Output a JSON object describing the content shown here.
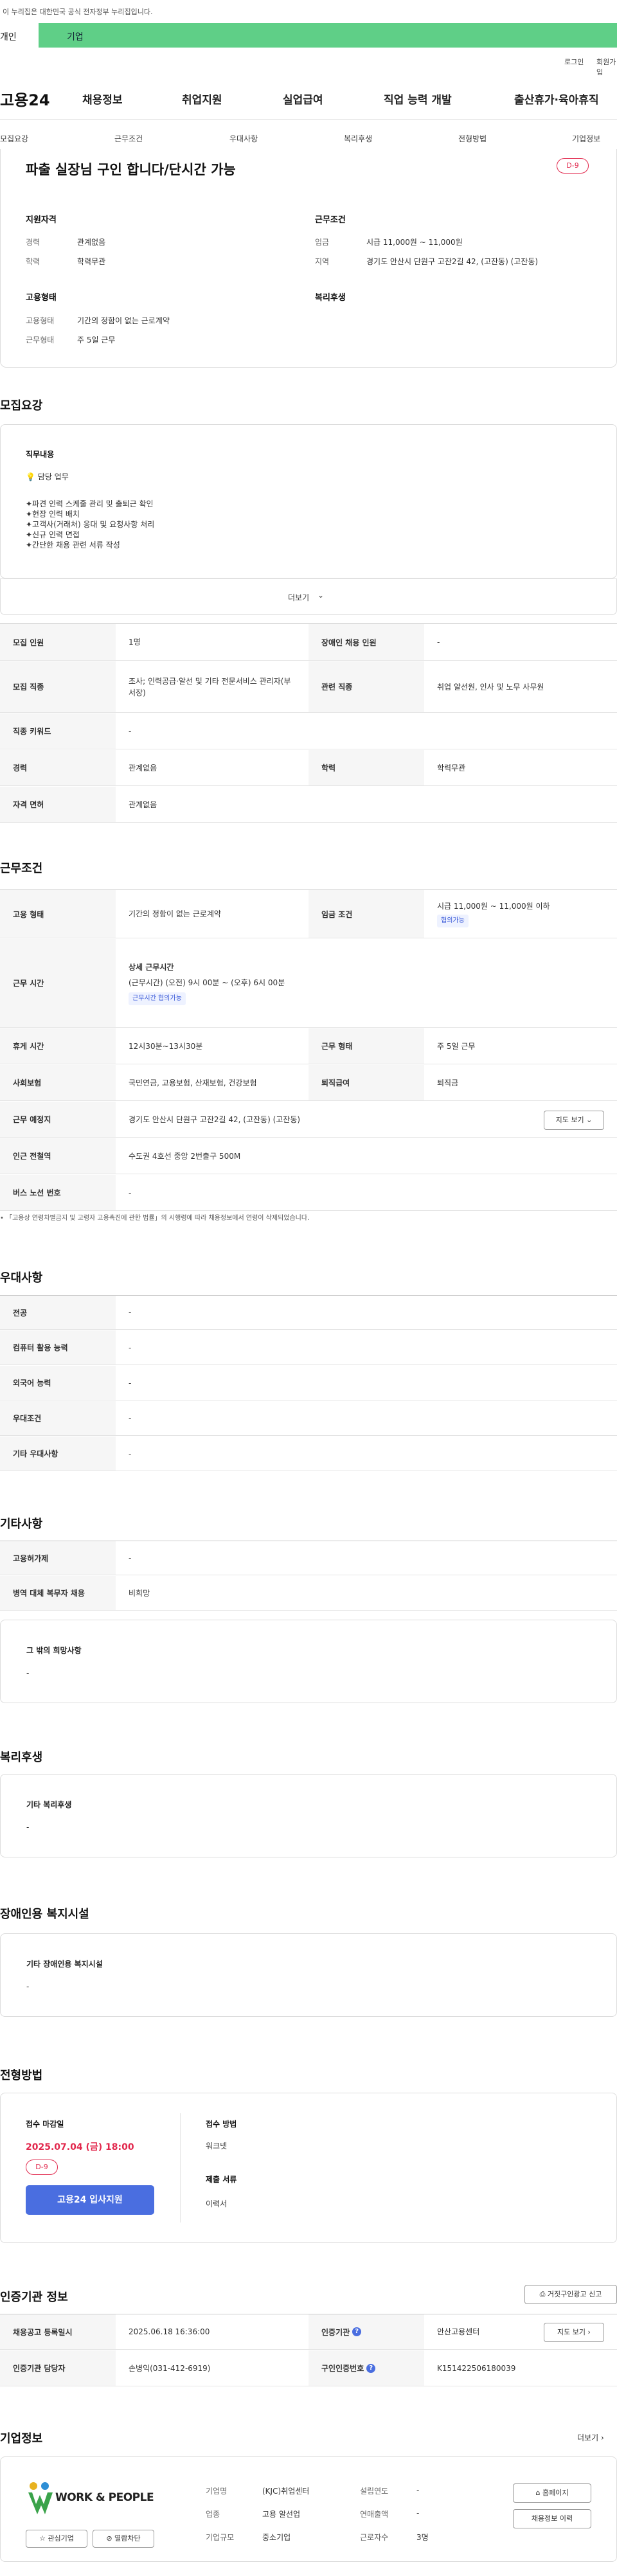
{
  "gov_notice": "이 누리집은 대한민국 공식 전자정부 누리집입니다.",
  "top_tabs": [
    "개인",
    "기업"
  ],
  "util_links": [
    "로그인",
    "회원가입"
  ],
  "logo": "고용24",
  "gnb": [
    "채용정보",
    "취업지원",
    "실업급여",
    "직업 능력 개발",
    "출산휴가·육아휴직"
  ],
  "subnav": [
    "모집요강",
    "근무조건",
    "우대사항",
    "복리후생",
    "전형방법",
    "기업정보"
  ],
  "job": {
    "title": "파출 실장님 구인 합니다/단시간 가능",
    "dday": "D-9",
    "qualification_title": "지원자격",
    "career_label": "경력",
    "career_value": "관계없음",
    "edu_label": "학력",
    "edu_value": "학력무관",
    "conditions_title": "근무조건",
    "wage_label": "임금",
    "wage_value": "시급 11,000원 ~ 11,000원",
    "region_label": "지역",
    "region_value": "경기도 안산시 단원구 고잔2길 42, (고잔동) (고잔동)",
    "employment_title": "고용형태",
    "emptype_label": "고용형태",
    "emptype_value": "기간의 정함이 없는 근로계약",
    "worktype_label": "근무형태",
    "worktype_value": "주 5일 근무",
    "welfare_title": "복리후생"
  },
  "recruit": {
    "heading": "모집요강",
    "duty_title": "직무내용",
    "duty_sub": "담당 업무",
    "duty_lines": [
      "✦파견 인력 스케줄 관리 및 출퇴근 확인",
      "✦현장 인력 배치",
      "✦고객사(거래처) 응대 및 요청사항 처리",
      "✦신규 인력 면접",
      "✦간단한 채용 관련 서류 작성"
    ],
    "more": "더보기",
    "rows": {
      "count_label": "모집 인원",
      "count_value": "1명",
      "disabled_label": "장애인 채용 인원",
      "disabled_value": "-",
      "job_label": "모집 직종",
      "job_value": "조사; 인력공급·알선 및 기타 전문서비스 관리자(부서장)",
      "related_label": "관련 직종",
      "related_value": "취업 알선원, 인사 및 노무 사무원",
      "keyword_label": "직종 키워드",
      "keyword_value": "-",
      "career_label": "경력",
      "career_value": "관계없음",
      "edu_label": "학력",
      "edu_value": "학력무관",
      "license_label": "자격 면허",
      "license_value": "관계없음"
    }
  },
  "conditions": {
    "heading": "근무조건",
    "emptype_label": "고용 형태",
    "emptype_value": "기간의 정함이 없는 근로계약",
    "wage_label": "임금 조건",
    "wage_value": "시급 11,000원 ~ 11,000원 이하",
    "wage_chip": "협의가능",
    "time_label": "근무 시간",
    "time_title": "상세 근무시간",
    "time_value": "(근무시간) (오전) 9시 00분 ~ (오후) 6시 00분",
    "time_chip": "근무시간 협의가능",
    "break_label": "휴게 시간",
    "break_value": "12시30분~13시30분",
    "form_label": "근무 형태",
    "form_value": "주 5일 근무",
    "insurance_label": "사회보험",
    "insurance_value": "국민연금, 고용보험, 산재보험, 건강보험",
    "severance_label": "퇴직급여",
    "severance_value": "퇴직금",
    "place_label": "근무 예정지",
    "place_value": "경기도 안산시 단원구 고잔2길 42, (고잔동) (고잔동)",
    "map_btn": "지도 보기",
    "subway_label": "인근 전철역",
    "subway_value": "수도권 4호선 중앙 2번출구 500M",
    "bus_label": "버스 노선 번호",
    "bus_value": "-",
    "notice": "「고용상 연령차별금지 및 고령자 고용촉진에 관한 법률」의 시행령에 따라 채용정보에서 연령이 삭제되었습니다."
  },
  "preference": {
    "heading": "우대사항",
    "rows": [
      {
        "label": "전공",
        "value": "-"
      },
      {
        "label": "컴퓨터 활용 능력",
        "value": "-"
      },
      {
        "label": "외국어 능력",
        "value": "-"
      },
      {
        "label": "우대조건",
        "value": "-"
      },
      {
        "label": "기타 우대사항",
        "value": "-"
      }
    ]
  },
  "other": {
    "heading": "기타사항",
    "rows": [
      {
        "label": "고용허가제",
        "value": "-"
      },
      {
        "label": "병역 대체 복무자 채용",
        "value": "비희망"
      }
    ],
    "etc_title": "그 밖의 희망사항",
    "etc_value": "-"
  },
  "welfare": {
    "heading": "복리후생",
    "box_title": "기타 복리후생",
    "box_value": "-"
  },
  "disability": {
    "heading": "장애인용 복지시설",
    "box_title": "기타 장애인용 복지시설",
    "box_value": "-"
  },
  "selection": {
    "heading": "전형방법",
    "deadline_label": "접수 마감일",
    "deadline_value": "2025.07.04 (금) 18:00",
    "dday": "D-9",
    "apply_btn": "고용24 입사지원",
    "method_label": "접수 방법",
    "method_value": "워크넷",
    "docs_label": "제출 서류",
    "docs_value": "이력서"
  },
  "agency": {
    "heading": "인증기관 정보",
    "report_btn": "거짓구인광고 신고",
    "reg_label": "채용공고 등록일시",
    "reg_value": "2025.06.18 16:36:00",
    "org_label": "인증기관",
    "org_value": "안산고용센터",
    "map_btn": "지도 보기",
    "manager_label": "인증기관 담당자",
    "manager_value": "손병익(031-412-6919)",
    "auth_label": "구인인증번호",
    "auth_value": "K151422506180039"
  },
  "company": {
    "heading": "기업정보",
    "more": "더보기",
    "logo_text": "WORK & PEOPLE",
    "interest_btn": "관심기업",
    "block_btn": "열람차단",
    "name_label": "기업명",
    "name_value": "(KJC)취업센터",
    "industry_label": "업종",
    "industry_value": "고용 알선업",
    "scale_label": "기업규모",
    "scale_value": "중소기업",
    "founded_label": "설립연도",
    "founded_value": "-",
    "sales_label": "연매출액",
    "sales_value": "-",
    "staff_label": "근로자수",
    "staff_value": "3명",
    "homepage_btn": "홈페이지",
    "jobs_btn": "채용정보 이력"
  }
}
